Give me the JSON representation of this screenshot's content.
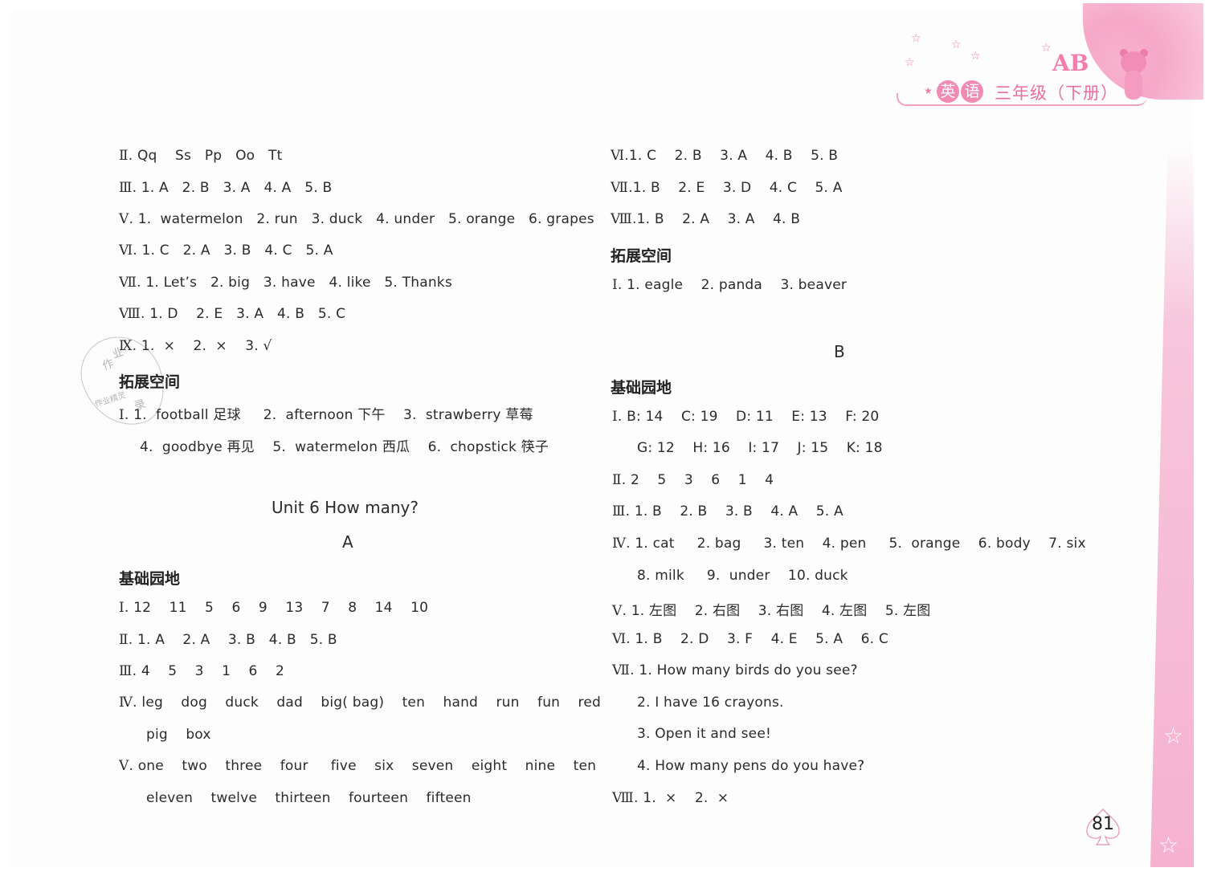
{
  "header": {
    "badge_chars": [
      "英",
      "语"
    ],
    "grade": "三年级（下册）",
    "letters": "AB"
  },
  "left": {
    "lines": [
      {
        "numeral": "Ⅱ.",
        "text": "Qq    Ss   Pp   Oo   Tt"
      },
      {
        "numeral": "Ⅲ.",
        "text": "1. A   2. B   3. A   4. A   5. B"
      },
      {
        "numeral": "Ⅴ.",
        "text": "1.  watermelon   2. run   3. duck   4. under   5. orange   6. grapes"
      },
      {
        "numeral": "Ⅵ.",
        "text": "1. C   2. A   3. B   4. C   5. A"
      },
      {
        "numeral": "Ⅶ.",
        "text": "1. Let’s   2. big   3. have   4. like   5. Thanks"
      },
      {
        "numeral": "Ⅷ.",
        "text": "1. D    2. E   3. A   4. B   5. C"
      },
      {
        "numeral": "Ⅸ.",
        "text": "1.  ×    2.  ×    3. √"
      }
    ],
    "extension_heading": "拓展空间",
    "extension_lines": [
      {
        "numeral": "Ⅰ.",
        "text": "1.  football 足球     2.  afternoon 下午    3.  strawberry 草莓"
      },
      {
        "numeral": "",
        "text": "4.  goodbye 再见    5.  watermelon 西瓜    6.  chopstick 筷子"
      }
    ],
    "unit_title": "Unit 6    How many?",
    "part_a": "A",
    "basic_heading": "基础园地",
    "basic_lines": [
      {
        "numeral": "Ⅰ.",
        "text": "12    11    5    6    9    13    7    8    14    10"
      },
      {
        "numeral": "Ⅱ.",
        "text": "1. A    2. A    3. B   4. B   5. B"
      },
      {
        "numeral": "Ⅲ.",
        "text": "4    5    3    1    6    2"
      },
      {
        "numeral": "Ⅳ.",
        "text": "leg    dog    duck    dad    big( bag)    ten    hand    run    fun    red"
      },
      {
        "numeral": "",
        "text": "pig    box"
      },
      {
        "numeral": "Ⅴ.",
        "text": "one    two    three    four     five    six    seven    eight    nine    ten"
      },
      {
        "numeral": "",
        "text": "eleven    twelve    thirteen    fourteen    fifteen"
      }
    ]
  },
  "right": {
    "lines": [
      {
        "numeral": "Ⅵ.",
        "text": "1. C    2. B    3. A    4. B    5. B"
      },
      {
        "numeral": "Ⅶ.",
        "text": "1. B    2. E    3. D    4. C    5. A"
      },
      {
        "numeral": "Ⅷ.",
        "text": "1. B    2. A    3. A    4. B"
      }
    ],
    "extension_heading": "拓展空间",
    "extension_lines": [
      {
        "numeral": "Ⅰ.",
        "text": "1. eagle    2. panda    3. beaver"
      }
    ],
    "part_b": "B",
    "basic_heading": "基础园地",
    "basic_lines": [
      {
        "numeral": "Ⅰ.",
        "text": "B: 14    C: 19    D: 11    E: 13    F: 20"
      },
      {
        "numeral": "",
        "text": "G: 12    H: 16    I: 17    J: 15    K: 18"
      },
      {
        "numeral": "Ⅱ.",
        "text": "2    5    3    6    1    4"
      },
      {
        "numeral": "Ⅲ.",
        "text": "1. B    2. B    3. B    4. A    5. A"
      },
      {
        "numeral": "Ⅳ.",
        "text": "1. cat     2. bag     3. ten    4. pen     5.  orange    6. body    7. six"
      },
      {
        "numeral": "",
        "text": "8. milk     9.  under    10. duck"
      },
      {
        "numeral": "Ⅴ.",
        "text": "1. 左图    2. 右图    3. 右图    4. 左图    5. 左图"
      },
      {
        "numeral": "Ⅵ.",
        "text": "1. B    2. D    3. F    4. E    5. A    6. C"
      },
      {
        "numeral": "Ⅶ.",
        "text": "1. How many birds do you see?"
      },
      {
        "numeral": "",
        "text": "2. I have 16 crayons."
      },
      {
        "numeral": "",
        "text": "3. Open it and see!"
      },
      {
        "numeral": "",
        "text": "4. How many pens do you have?"
      },
      {
        "numeral": "Ⅷ.",
        "text": "1.  ×    2.  ×"
      }
    ]
  },
  "stamp": {
    "chars": [
      "作",
      "业",
      "作业精灵",
      "录"
    ]
  },
  "page_number": "81",
  "colors": {
    "accent_pink": "#f08bb4",
    "text": "#2b2b2b"
  }
}
